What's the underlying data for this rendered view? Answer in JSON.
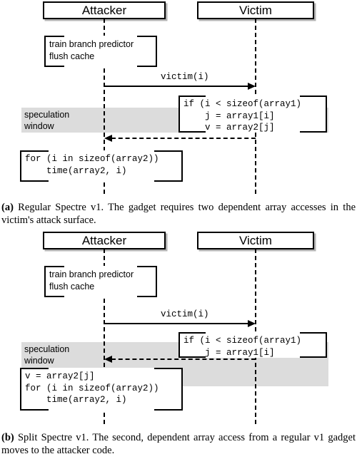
{
  "figure": {
    "title": "Regular versus Split Spectre v1 sequence diagrams",
    "colors": {
      "line": "#000000",
      "background": "#ffffff",
      "speculation_band": "#dcdcdc",
      "note_fill": "#ffffff"
    }
  },
  "subfigure_a": {
    "id": "a",
    "participants": {
      "attacker": "Attacker",
      "victim": "Victim"
    },
    "attacker_setup_note": "train branch predictor\nflush cache",
    "call_message": {
      "label": "victim(i)",
      "direction": "attacker-to-victim",
      "style": "solid"
    },
    "victim_gadget_note": "if (i < sizeof(array1)\n    j = array1[i]\n    v = array2[j]",
    "speculation_window_label": "speculation\nwindow",
    "return_message": {
      "label": "",
      "direction": "victim-to-attacker",
      "style": "dashed"
    },
    "attacker_timing_note": "for (i in sizeof(array2))\n    time(array2, i)",
    "caption_label": "(a)",
    "caption_text": "Regular Spectre v1. The gadget requires two dependent array accesses in the victim's attack surface."
  },
  "subfigure_b": {
    "id": "b",
    "participants": {
      "attacker": "Attacker",
      "victim": "Victim"
    },
    "attacker_setup_note": "train branch predictor\nflush cache",
    "call_message": {
      "label": "victim(i)",
      "direction": "attacker-to-victim",
      "style": "solid"
    },
    "victim_gadget_note": "if (i < sizeof(array1)\n    j = array1[i]",
    "speculation_window_label": "speculation\nwindow",
    "return_message": {
      "label": "",
      "direction": "victim-to-attacker",
      "style": "dashed"
    },
    "attacker_timing_note": "v = array2[j]\nfor (i in sizeof(array2))\n    time(array2, i)",
    "caption_label": "(b)",
    "caption_text": "Split Spectre v1. The second, dependent array access from a regular v1 gadget moves to the attacker code."
  }
}
